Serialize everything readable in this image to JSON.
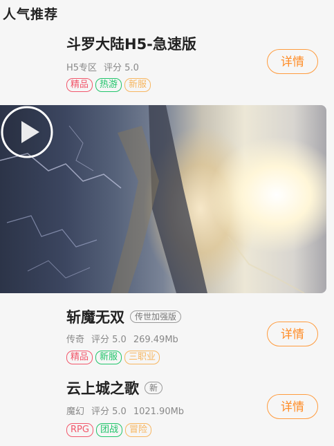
{
  "section": {
    "title": "人气推荐"
  },
  "games": [
    {
      "name": "斗罗大陆H5-急速版",
      "badge": "",
      "category": "H5专区",
      "rating": "评分 5.0",
      "size": "",
      "tags": [
        "精品",
        "热游",
        "新服"
      ],
      "button": "详情"
    },
    {
      "name": "斩魔无双",
      "badge": "传世加强版",
      "category": "传奇",
      "rating": "评分 5.0",
      "size": "269.49Mb",
      "tags": [
        "精品",
        "新服",
        "三职业"
      ],
      "button": "详情"
    },
    {
      "name": "云上城之歌",
      "badge": "新",
      "category": "魔幻",
      "rating": "评分 5.0",
      "size": "1021.90Mb",
      "tags": [
        "RPG",
        "团战",
        "冒险"
      ],
      "button": "详情"
    }
  ],
  "video": {
    "icon": "play-circle-icon"
  },
  "colors": {
    "accent": "#ff8c26",
    "tag_red": "#f2566a",
    "tag_green": "#20c46a",
    "tag_orange": "#f7b660"
  }
}
